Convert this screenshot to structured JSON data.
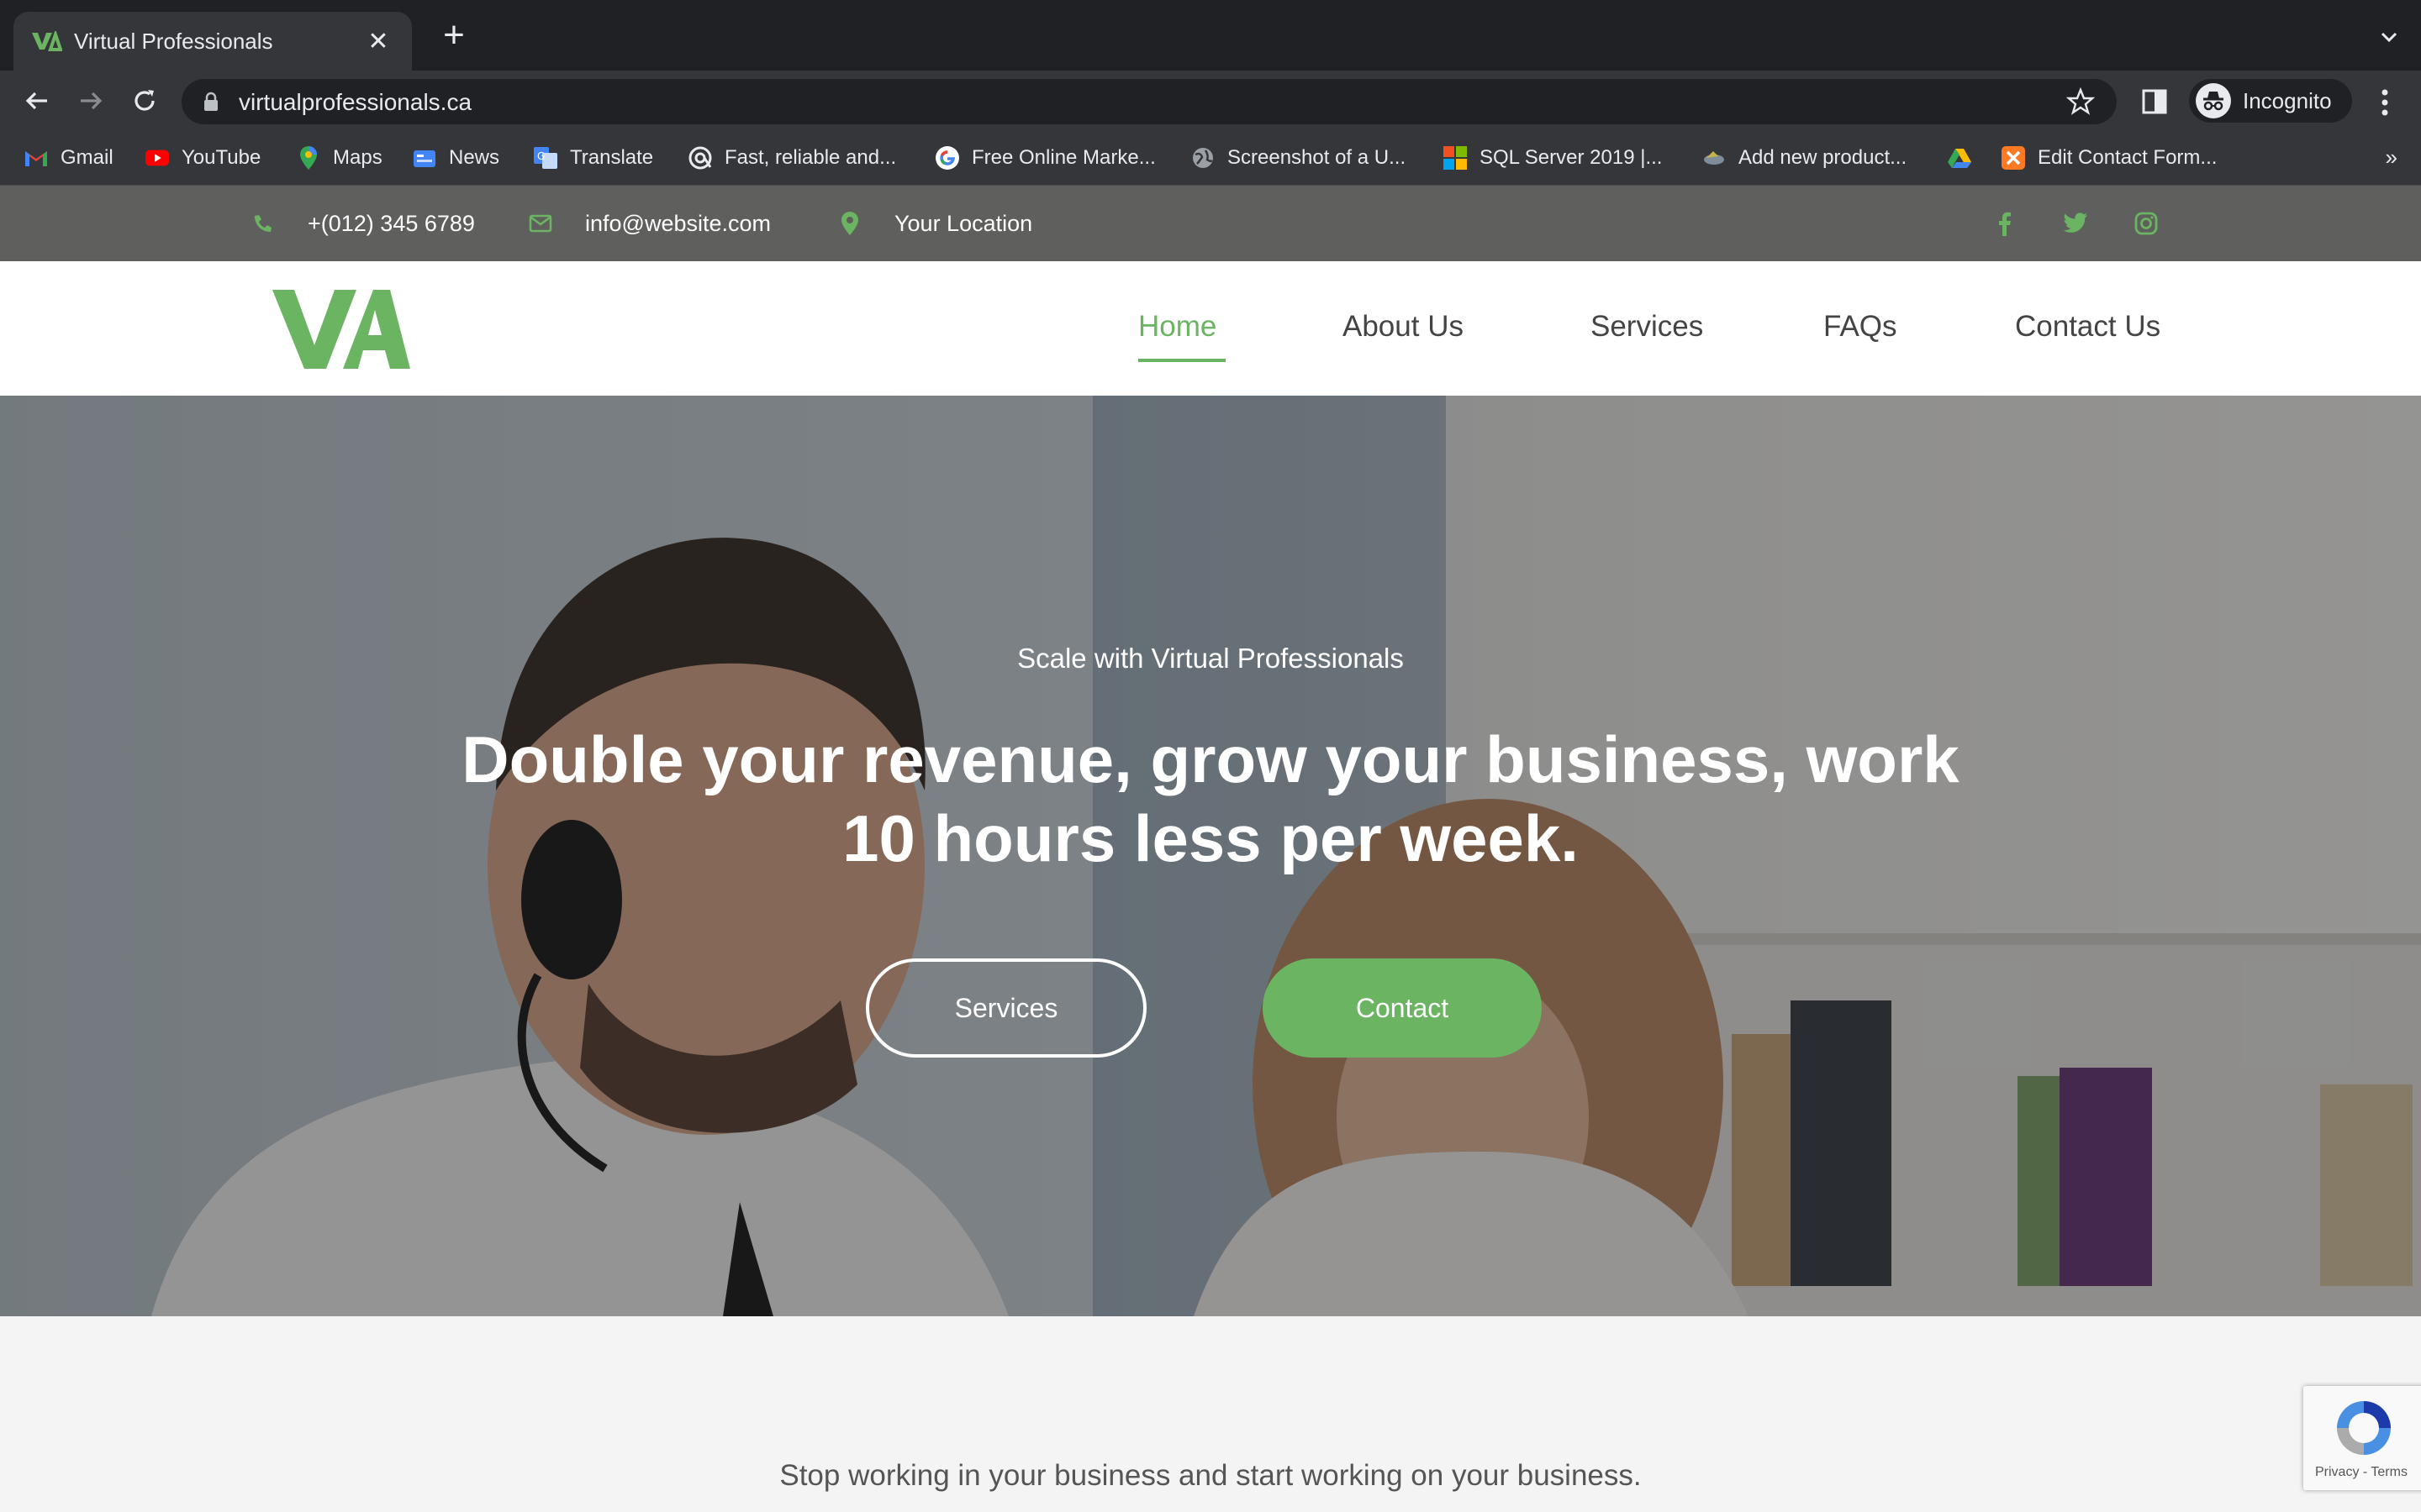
{
  "browser": {
    "tab_title": "Virtual Professionals",
    "tab_close": "✕",
    "new_tab": "+",
    "url": "virtualprofessionals.ca",
    "profile_label": "Incognito",
    "bookmarks": [
      {
        "label": "Gmail",
        "icon": "gmail-icon"
      },
      {
        "label": "YouTube",
        "icon": "youtube-icon"
      },
      {
        "label": "Maps",
        "icon": "maps-icon"
      },
      {
        "label": "News",
        "icon": "news-icon"
      },
      {
        "label": "Translate",
        "icon": "translate-icon"
      },
      {
        "label": "Fast, reliable and...",
        "icon": "at-sign-icon"
      },
      {
        "label": "Free Online Marke...",
        "icon": "google-icon"
      },
      {
        "label": "Screenshot of a U...",
        "icon": "globe-icon"
      },
      {
        "label": "SQL Server 2019 |...",
        "icon": "microsoft-icon"
      },
      {
        "label": "Add new product...",
        "icon": "bird-icon"
      },
      {
        "label": "",
        "icon": "drive-icon"
      },
      {
        "label": "Edit Contact Form...",
        "icon": "xampp-icon"
      }
    ],
    "bookmarks_more": "»"
  },
  "site": {
    "topbar": {
      "phone": "+(012) 345 6789",
      "email": "info@website.com",
      "location": "Your Location"
    },
    "nav": {
      "home": "Home",
      "about": "About Us",
      "services": "Services",
      "faqs": "FAQs",
      "contact": "Contact Us"
    },
    "hero": {
      "kicker": "Scale with Virtual Professionals",
      "title": "Double your revenue, grow your business, work 10 hours less per week.",
      "services_button": "Services",
      "contact_button": "Contact"
    },
    "tagline": "Stop working in your business and start working on your business.",
    "recaptcha_links": "Privacy - Terms"
  },
  "colors": {
    "accent": "#6ab462",
    "topbar_bg": "#5f5f5e",
    "chrome_dark": "#202124",
    "chrome_mid": "#35363a"
  }
}
